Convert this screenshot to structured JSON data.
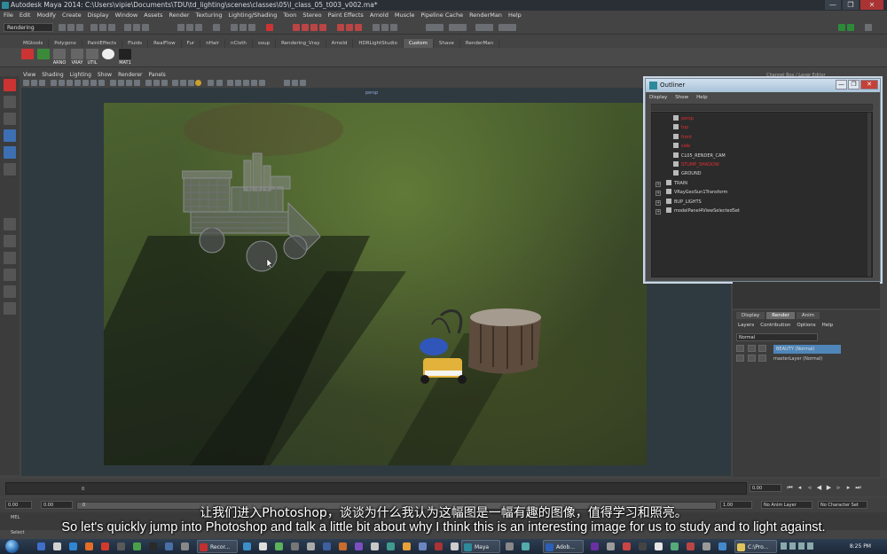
{
  "window": {
    "title": "Autodesk Maya 2014: C:\\Users\\vipie\\Documents\\TDU\\td_lighting\\scenes\\classes\\05\\l_class_05_t003_v002.ma*",
    "buttons": {
      "minimize": "—",
      "maximize": "❐",
      "close": "✕"
    }
  },
  "menubar": [
    "File",
    "Edit",
    "Modify",
    "Create",
    "Display",
    "Window",
    "Assets",
    "Render",
    "Texturing",
    "Lighting/Shading",
    "Toon",
    "Stereo",
    "Paint Effects",
    "Arnold",
    "Muscle",
    "Pipeline Cache",
    "RenderMan",
    "Help"
  ],
  "statusline": {
    "mode": "Rendering"
  },
  "shelf": {
    "tabs": [
      "MGtools",
      "Polygons",
      "PaintEffects",
      "Fluids",
      "RealFlow",
      "Fur",
      "nHair",
      "nCloth",
      "soup",
      "Rendering_Vray",
      "Arnold",
      "HDRLightStudio",
      "Custom",
      "Shave",
      "RenderMan"
    ],
    "active_tab": "Custom",
    "items": [
      "",
      "",
      "ARNO",
      "VRAY",
      "UTIL",
      "",
      "MAT1"
    ]
  },
  "panel": {
    "menus": [
      "View",
      "Shading",
      "Lighting",
      "Show",
      "Renderer",
      "Panels"
    ],
    "camera_label": "persp"
  },
  "outliner": {
    "title": "Outliner",
    "menus": [
      "Display",
      "Show",
      "Help"
    ],
    "items": [
      {
        "label": "persp",
        "color": "#e03030",
        "expandable": false
      },
      {
        "label": "top",
        "color": "#e03030",
        "expandable": false
      },
      {
        "label": "front",
        "color": "#e03030",
        "expandable": false
      },
      {
        "label": "side",
        "color": "#e03030",
        "expandable": false
      },
      {
        "label": "CL05_RENDER_CAM",
        "color": "#d8d8d8",
        "expandable": false
      },
      {
        "label": "STUMP_SHADOW",
        "color": "#e03030",
        "expandable": false
      },
      {
        "label": "GROUND",
        "color": "#d8d8d8",
        "expandable": false
      },
      {
        "label": "TRAIN",
        "color": "#d8d8d8",
        "expandable": true
      },
      {
        "label": "VRayGeoSun1Transform",
        "color": "#d8d8d8",
        "expandable": true
      },
      {
        "label": "BUP_LIGHTS",
        "color": "#d8d8d8",
        "expandable": true
      },
      {
        "label": "modelPanel4ViewSelectedSet",
        "color": "#d8d8d8",
        "expandable": true
      }
    ]
  },
  "channel_box": {
    "header": "Channel Box / Layer Editor"
  },
  "layer_editor": {
    "tabs": [
      "Display",
      "Render",
      "Anim"
    ],
    "active_tab": "Render",
    "menus": [
      "Layers",
      "Contribution",
      "Options",
      "Help"
    ],
    "blend_mode": "Normal",
    "layers": [
      {
        "name": "BEAUTY (Normal)",
        "selected": true
      },
      {
        "name": "masterLayer (Normal)",
        "selected": false
      }
    ]
  },
  "timeline": {
    "start_marker": "0",
    "current_frame": "0.00",
    "range_start": "0.00",
    "range_inner_start": "0.00",
    "range_slider_start": "0",
    "range_end": "1.00",
    "anim_layer": "No Anim Layer",
    "character_set": "No Character Set"
  },
  "commandline": {
    "label": "MEL",
    "status": "Select"
  },
  "subtitles": {
    "zh": "让我们进入Photoshop，谈谈为什么我认为这幅图是一幅有趣的图像，值得学习和照亮。",
    "en": "So let's quickly jump into Photoshop and talk a little bit about why I think this is an interesting image for us to study and to light against."
  },
  "taskbar": {
    "items": [
      "Recor...",
      "Maya",
      "Adob...",
      "C:\\Pro..."
    ],
    "time": "8:25 PM"
  },
  "colors": {
    "accent_active_layer": "#4f86b9",
    "outliner_frame": "#c9d6e2",
    "error_red": "#e03030"
  }
}
